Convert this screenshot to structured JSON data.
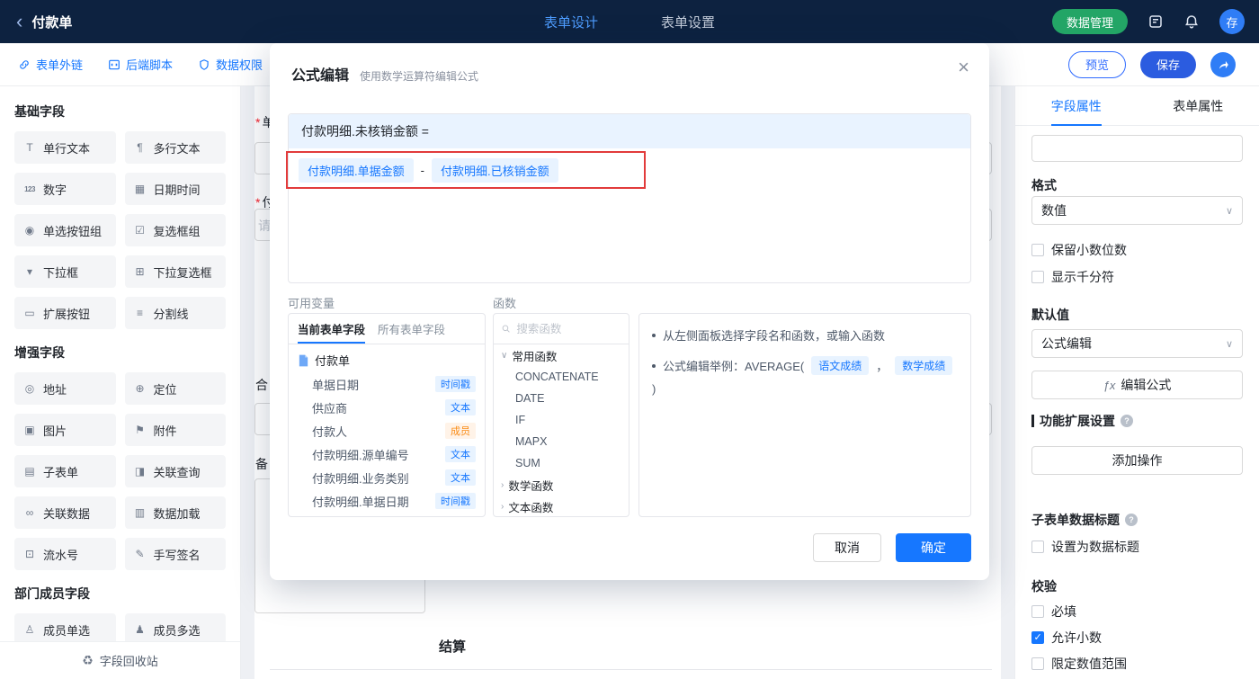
{
  "colors": {
    "accent": "#1677ff",
    "topbar_bg": "#0d2240",
    "green_button": "#23a566",
    "save_button": "#2b5ce0",
    "active_tab_blue": "#4e9dff",
    "annotation_red": "#e23b3b",
    "tag_blue_text": "#1677ff",
    "tag_orange_text": "#fa8c16"
  },
  "icons": {
    "back": "‹",
    "close": "×",
    "chevron_down": "∨",
    "chevron_right": "›",
    "dropdown": "∨",
    "help": "?",
    "fx": "ƒx",
    "recycle": "♻"
  },
  "topbar": {
    "title": "付款单",
    "tab_design": "表单设计",
    "tab_settings": "表单设置",
    "data_manage": "数据管理",
    "avatar": "存"
  },
  "toolbar": {
    "link_external": "表单外链",
    "link_script": "后端脚本",
    "link_permission": "数据权限",
    "preview": "预览",
    "save": "保存"
  },
  "sidebar": {
    "section_basic": "基础字段",
    "basic_items": [
      {
        "label": "单行文本",
        "icon": "single-line-text-icon",
        "glyph": "T"
      },
      {
        "label": "多行文本",
        "icon": "multi-line-text-icon",
        "glyph": "¶"
      },
      {
        "label": "数字",
        "icon": "number-icon",
        "glyph": "123"
      },
      {
        "label": "日期时间",
        "icon": "datetime-icon",
        "glyph": "▦"
      },
      {
        "label": "单选按钮组",
        "icon": "radio-group-icon",
        "glyph": "◉"
      },
      {
        "label": "复选框组",
        "icon": "checkbox-group-icon",
        "glyph": "☑"
      },
      {
        "label": "下拉框",
        "icon": "dropdown-icon",
        "glyph": "▾"
      },
      {
        "label": "下拉复选框",
        "icon": "multi-dropdown-icon",
        "glyph": "⊞"
      },
      {
        "label": "扩展按钮",
        "icon": "extend-button-icon",
        "glyph": "▭"
      },
      {
        "label": "分割线",
        "icon": "divider-icon",
        "glyph": "≡"
      }
    ],
    "section_enhanced": "增强字段",
    "enhanced_items": [
      {
        "label": "地址",
        "icon": "address-icon",
        "glyph": "◎"
      },
      {
        "label": "定位",
        "icon": "location-icon",
        "glyph": "⊕"
      },
      {
        "label": "图片",
        "icon": "image-icon",
        "glyph": "▣"
      },
      {
        "label": "附件",
        "icon": "attachment-icon",
        "glyph": "⚑"
      },
      {
        "label": "子表单",
        "icon": "subform-icon",
        "glyph": "▤"
      },
      {
        "label": "关联查询",
        "icon": "related-query-icon",
        "glyph": "◨"
      },
      {
        "label": "关联数据",
        "icon": "related-data-icon",
        "glyph": "∞"
      },
      {
        "label": "数据加载",
        "icon": "data-load-icon",
        "glyph": "▥"
      },
      {
        "label": "流水号",
        "icon": "serial-number-icon",
        "glyph": "⊡"
      },
      {
        "label": "手写签名",
        "icon": "signature-icon",
        "glyph": "✎"
      }
    ],
    "section_member": "部门成员字段",
    "member_items": [
      {
        "label": "成员单选",
        "icon": "member-single-icon",
        "glyph": "♙"
      },
      {
        "label": "成员多选",
        "icon": "member-multi-icon",
        "glyph": "♟"
      }
    ],
    "recycle": "字段回收站"
  },
  "canvas": {
    "partial_labels": [
      {
        "req": "*",
        "text": "单"
      },
      {
        "req": "*",
        "text": "付"
      },
      {
        "req": "",
        "text": "请"
      },
      {
        "req": "",
        "text": "合"
      },
      {
        "req": "",
        "text": "备"
      }
    ],
    "section_settlement": "结算"
  },
  "modal": {
    "title": "公式编辑",
    "subtitle": "使用数学运算符编辑公式",
    "target": "付款明细.未核销金额 =",
    "operand_left": "付款明细.单据金额",
    "operator": "-",
    "operand_right": "付款明细.已核销金额",
    "variables_label": "可用变量",
    "tab_current": "当前表单字段",
    "tab_all": "所有表单字段",
    "tree_root": "付款单",
    "fields": [
      {
        "name": "单据日期",
        "tag": "时间戳",
        "tag_color": "blue"
      },
      {
        "name": "供应商",
        "tag": "文本",
        "tag_color": "blue"
      },
      {
        "name": "付款人",
        "tag": "成员",
        "tag_color": "orange"
      },
      {
        "name": "付款明细.源单编号",
        "tag": "文本",
        "tag_color": "blue"
      },
      {
        "name": "付款明细.业务类别",
        "tag": "文本",
        "tag_color": "blue"
      },
      {
        "name": "付款明细.单据日期",
        "tag": "时间戳",
        "tag_color": "blue"
      }
    ],
    "functions_label": "函数",
    "search_placeholder": "搜索函数",
    "group_common": "常用函数",
    "common_functions": [
      "CONCATENATE",
      "DATE",
      "IF",
      "MAPX",
      "SUM"
    ],
    "group_math": "数学函数",
    "group_text": "文本函数",
    "tip1": "从左侧面板选择字段名和函数，或输入函数",
    "tip2_prefix": "公式编辑举例：AVERAGE(",
    "tip2_chip1": "语文成绩",
    "tip2_sep": "，",
    "tip2_chip2": "数学成绩",
    "tip2_suffix": ")",
    "cancel": "取消",
    "ok": "确定"
  },
  "right_panel": {
    "tab_field": "字段属性",
    "tab_form": "表单属性",
    "format_label": "格式",
    "format_value": "数值",
    "opt_decimal": "保留小数位数",
    "opt_thousand": "显示千分符",
    "default_label": "默认值",
    "default_value": "公式编辑",
    "edit_formula": "编辑公式",
    "ext_title": "功能扩展设置",
    "add_action": "添加操作",
    "subform_title": "子表单数据标题",
    "opt_data_title": "设置为数据标题",
    "validation_title": "校验",
    "opt_required": "必填",
    "opt_allow_decimal": "允许小数",
    "opt_range": "限定数值范围"
  }
}
